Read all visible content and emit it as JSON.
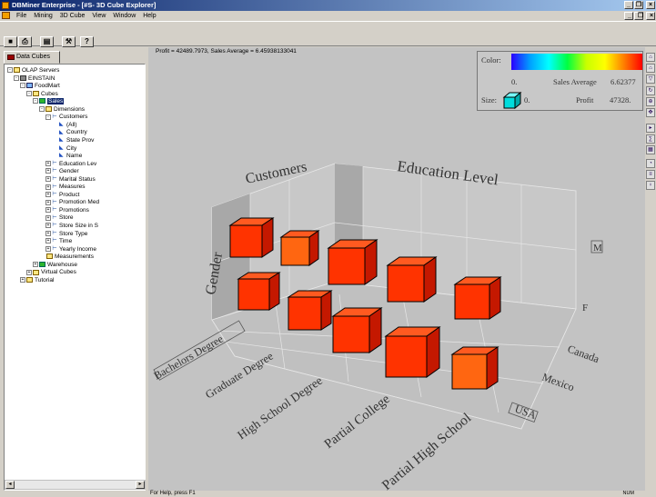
{
  "window": {
    "title": "DBMiner Enterprise - [#S- 3D Cube Explorer]",
    "min_glyph": "_",
    "restore_glyph": "❐",
    "close_glyph": "×"
  },
  "menu": [
    "File",
    "Mining",
    "3D Cube",
    "View",
    "Window",
    "Help"
  ],
  "toolbar": {
    "buttons": [
      {
        "name": "save-button",
        "glyph": "■"
      },
      {
        "name": "print-button",
        "glyph": "⎙"
      },
      {
        "name": "view-button",
        "glyph": "▤"
      },
      {
        "name": "mining-button",
        "glyph": "⚒"
      },
      {
        "name": "help-button",
        "glyph": "?"
      }
    ]
  },
  "left_panel": {
    "tab_label": "Data Cubes",
    "scroll_left": "◂",
    "scroll_right": "▸",
    "tree": [
      {
        "label": "OLAP Servers",
        "depth": 0,
        "icon": "folder",
        "tog": "-"
      },
      {
        "label": "EINSTAIN",
        "depth": 1,
        "icon": "server",
        "tog": "-"
      },
      {
        "label": "FoodMart",
        "depth": 2,
        "icon": "database",
        "tog": "-"
      },
      {
        "label": "Cubes",
        "depth": 3,
        "icon": "folder",
        "tog": "-"
      },
      {
        "label": "Sales",
        "depth": 4,
        "icon": "cube",
        "tog": "-",
        "selected": true
      },
      {
        "label": "Dimensions",
        "depth": 5,
        "icon": "folder",
        "tog": "-"
      },
      {
        "label": "Customers",
        "depth": 6,
        "icon": "dimension",
        "tog": "-"
      },
      {
        "label": "(All)",
        "depth": 7,
        "icon": "level",
        "tog": ""
      },
      {
        "label": "Country",
        "depth": 7,
        "icon": "level",
        "tog": ""
      },
      {
        "label": "State Prov",
        "depth": 7,
        "icon": "level",
        "tog": ""
      },
      {
        "label": "City",
        "depth": 7,
        "icon": "level",
        "tog": ""
      },
      {
        "label": "Name",
        "depth": 7,
        "icon": "level",
        "tog": ""
      },
      {
        "label": "Education Lev",
        "depth": 6,
        "icon": "dimension",
        "tog": "+"
      },
      {
        "label": "Gender",
        "depth": 6,
        "icon": "dimension",
        "tog": "+"
      },
      {
        "label": "Marital Status",
        "depth": 6,
        "icon": "dimension",
        "tog": "+"
      },
      {
        "label": "Measures",
        "depth": 6,
        "icon": "dimension",
        "tog": "+"
      },
      {
        "label": "Product",
        "depth": 6,
        "icon": "dimension",
        "tog": "+"
      },
      {
        "label": "Promotion Med",
        "depth": 6,
        "icon": "dimension",
        "tog": "+"
      },
      {
        "label": "Promotions",
        "depth": 6,
        "icon": "dimension",
        "tog": "+"
      },
      {
        "label": "Store",
        "depth": 6,
        "icon": "dimension",
        "tog": "+"
      },
      {
        "label": "Store Size in S",
        "depth": 6,
        "icon": "dimension",
        "tog": "+"
      },
      {
        "label": "Store Type",
        "depth": 6,
        "icon": "dimension",
        "tog": "+"
      },
      {
        "label": "Time",
        "depth": 6,
        "icon": "dimension",
        "tog": "+"
      },
      {
        "label": "Yearly Income",
        "depth": 6,
        "icon": "dimension",
        "tog": "+"
      },
      {
        "label": "Measurements",
        "depth": 5,
        "icon": "folder",
        "tog": ""
      },
      {
        "label": "Warehouse",
        "depth": 4,
        "icon": "cube",
        "tog": "+"
      },
      {
        "label": "Virtual Cubes",
        "depth": 3,
        "icon": "folder",
        "tog": "+"
      },
      {
        "label": "Tutorial",
        "depth": 2,
        "icon": "folder",
        "tog": "+"
      }
    ]
  },
  "explorer": {
    "info_line": "Profit = 42489.7973,  Sales Average = 6.45938133041",
    "legend": {
      "color_label": "Color:",
      "color_min": "0.",
      "color_measure": "Sales Average",
      "color_max": "6.62377",
      "size_label": "Size:",
      "size_min": "0.",
      "size_measure": "Profit",
      "size_max": "47328."
    },
    "axis_customers": "Customers",
    "axis_education": "Education Level",
    "axis_gender": "Gender",
    "gender_labels": [
      "M",
      "F"
    ],
    "country_labels": [
      "Canada",
      "Mexico",
      "USA"
    ],
    "education_labels": [
      "Bachelors Degree",
      "Graduate Degree",
      "High School Degree",
      "Partial College",
      "Partial High School"
    ]
  },
  "status": {
    "help_text": "For Help, press F1",
    "num": "NUM"
  },
  "colors": {
    "cube_fill": "#ff3300",
    "cube_dark": "#c41800",
    "cube_top": "#ff5a20",
    "cube_alt": "#ff6611"
  }
}
